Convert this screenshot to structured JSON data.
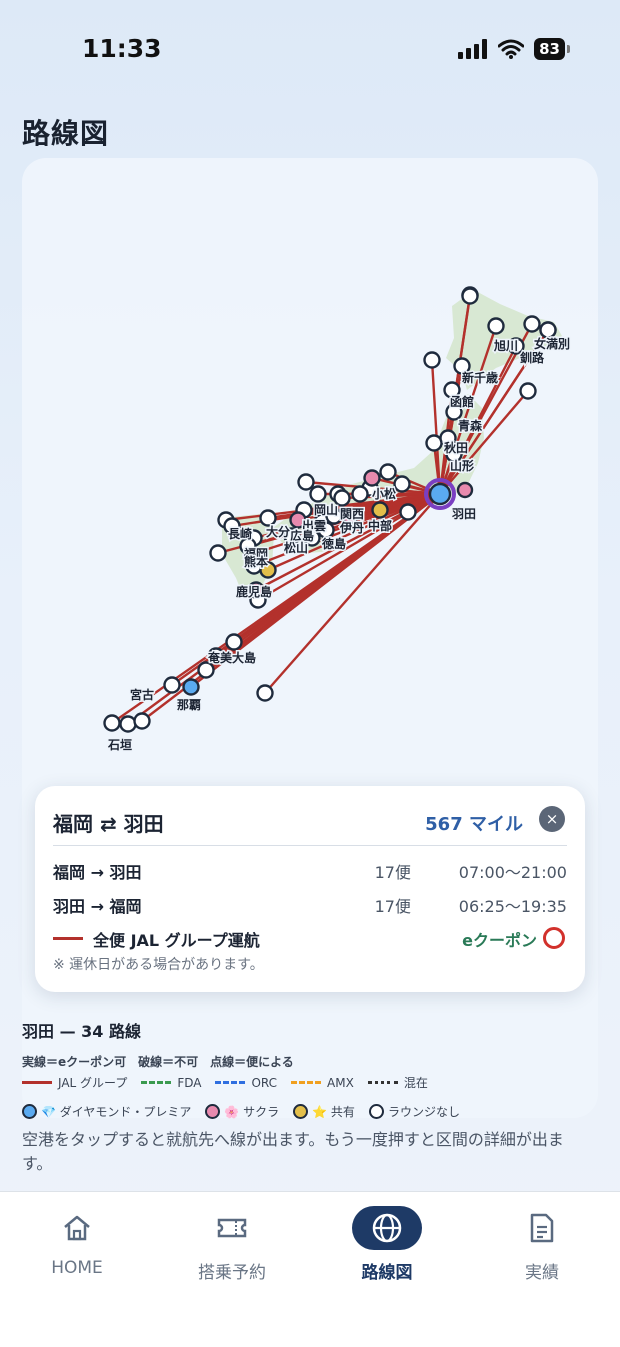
{
  "status": {
    "time": "11:33",
    "battery": "83"
  },
  "page": {
    "title": "路線図"
  },
  "map": {
    "airport_labels": {
      "haneda": "羽田",
      "asahikawa": "旭川",
      "memanbetsu": "女満別",
      "kushiro": "釧路",
      "shin_chitose": "新千歳",
      "hakodate": "函館",
      "aomori": "青森",
      "akita": "秋田",
      "yamagata": "山形",
      "okayama": "岡山",
      "kansai": "関西",
      "komatsu": "小松",
      "oita": "大分",
      "izumo": "出雲",
      "hiroshima": "広島",
      "matsuyama": "松山",
      "itami": "伊丹",
      "chubu": "中部",
      "tokushima": "徳島",
      "nagasaki": "長崎",
      "fukuoka": "福岡",
      "kumamoto": "熊本",
      "kagoshima": "鹿児島",
      "amami": "奄美大島",
      "miyako": "宮古",
      "naha": "那覇",
      "ishigaki": "石垣"
    },
    "colors": {
      "jal": "#b3312c",
      "land": "#d8e8d3",
      "ring": "#1f2b3d",
      "diamond": "#5aaaf0",
      "sakura": "#e88aae",
      "shared": "#e3bf4a",
      "hub": "#7a3fc2"
    }
  },
  "route_panel": {
    "title": "福岡 ⇄ 羽田",
    "miles": "567 マイル",
    "close_icon": "×",
    "rows": [
      {
        "segment": "福岡 → 羽田",
        "flights": "17便",
        "hours": "07:00〜21:00"
      },
      {
        "segment": "羽田 → 福岡",
        "flights": "17便",
        "hours": "06:25〜19:35"
      }
    ],
    "operator": "全便 JAL グループ運航",
    "coupon": "eクーポン",
    "note": "※ 運休日がある場合があります。"
  },
  "summary": "羽田 — 34 路線",
  "legend": {
    "head": "実線＝eクーポン可　破線＝不可　点線＝便による",
    "lines": [
      {
        "label": "JAL グループ",
        "color": "#b3312c",
        "style": "solid"
      },
      {
        "label": "FDA",
        "color": "#3a9a4f",
        "style": "dashed"
      },
      {
        "label": "ORC",
        "color": "#2f6fe0",
        "style": "dashed"
      },
      {
        "label": "AMX",
        "color": "#f0a020",
        "style": "dashed"
      },
      {
        "label": "混在",
        "color": "#333333",
        "style": "dotted"
      }
    ],
    "dots": [
      {
        "label": "💎 ダイヤモンド・プレミア",
        "color": "#5aaaf0"
      },
      {
        "label": "🌸 サクラ",
        "color": "#e88aae"
      },
      {
        "label": "⭐ 共有",
        "color": "#e3bf4a"
      },
      {
        "label": "ラウンジなし",
        "color": "#ffffff"
      }
    ]
  },
  "hint": "空港をタップすると就航先へ線が出ます。もう一度押すと区間の詳細が出ます。",
  "tabs": [
    {
      "label": "HOME",
      "icon": "home-icon",
      "active": false
    },
    {
      "label": "搭乗予約",
      "icon": "ticket-icon",
      "active": false
    },
    {
      "label": "路線図",
      "icon": "globe-icon",
      "active": true
    },
    {
      "label": "実績",
      "icon": "document-icon",
      "active": false
    }
  ]
}
